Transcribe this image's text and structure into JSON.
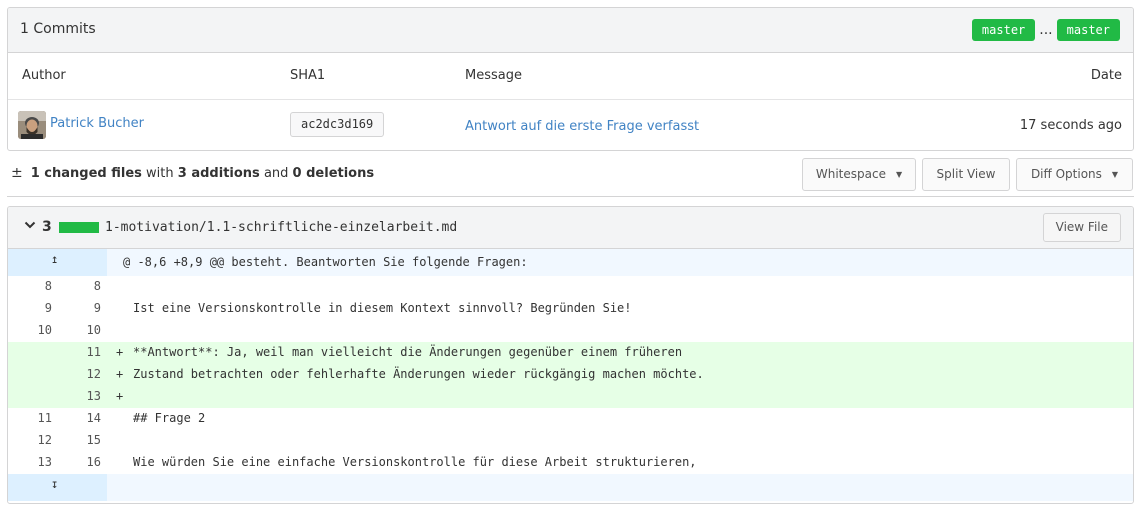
{
  "commits": {
    "title": "1 Commits",
    "branch_from": "master",
    "branch_sep": "...",
    "branch_to": "master",
    "columns": {
      "author": "Author",
      "sha": "SHA1",
      "message": "Message",
      "date": "Date"
    },
    "rows": [
      {
        "author": "Patrick Bucher",
        "sha": "ac2dc3d169",
        "message": "Antwort auf die erste Frage verfasst",
        "date": "17 seconds ago"
      }
    ]
  },
  "diff_summary": {
    "changed": "1 changed files",
    "with": "with",
    "additions": "3 additions",
    "and": "and",
    "deletions": "0 deletions",
    "buttons": {
      "whitespace": "Whitespace",
      "split_view": "Split View",
      "diff_options": "Diff Options"
    }
  },
  "file": {
    "count": "3",
    "name": "1-motivation/1.1-schriftliche-einzelarbeit.md",
    "view_file": "View File",
    "additions_fraction": 1.0,
    "hunk_header": "@ -8,6 +8,9 @@ besteht. Beantworten Sie folgende Fragen:",
    "lines": [
      {
        "type": "ctx",
        "old": "8",
        "new": "8",
        "sign": "",
        "text": ""
      },
      {
        "type": "ctx",
        "old": "9",
        "new": "9",
        "sign": "",
        "text": "Ist eine Versionskontrolle in diesem Kontext sinnvoll? Begründen Sie!"
      },
      {
        "type": "ctx",
        "old": "10",
        "new": "10",
        "sign": "",
        "text": ""
      },
      {
        "type": "add",
        "old": "",
        "new": "11",
        "sign": "+",
        "text": "**Antwort**: Ja, weil man vielleicht die Änderungen gegenüber einem früheren"
      },
      {
        "type": "add",
        "old": "",
        "new": "12",
        "sign": "+",
        "text": "Zustand betrachten oder fehlerhafte Änderungen wieder rückgängig machen möchte."
      },
      {
        "type": "add",
        "old": "",
        "new": "13",
        "sign": "+",
        "text": ""
      },
      {
        "type": "ctx",
        "old": "11",
        "new": "14",
        "sign": "",
        "text": "## Frage 2"
      },
      {
        "type": "ctx",
        "old": "12",
        "new": "15",
        "sign": "",
        "text": ""
      },
      {
        "type": "ctx",
        "old": "13",
        "new": "16",
        "sign": "",
        "text": "Wie würden Sie eine einfache Versionskontrolle für diese Arbeit strukturieren,"
      }
    ]
  },
  "colors": {
    "accent_green": "#21ba45",
    "link_blue": "#4183c4",
    "add_bg": "#e6ffe6",
    "hunk_bg": "#f1f8ff"
  }
}
